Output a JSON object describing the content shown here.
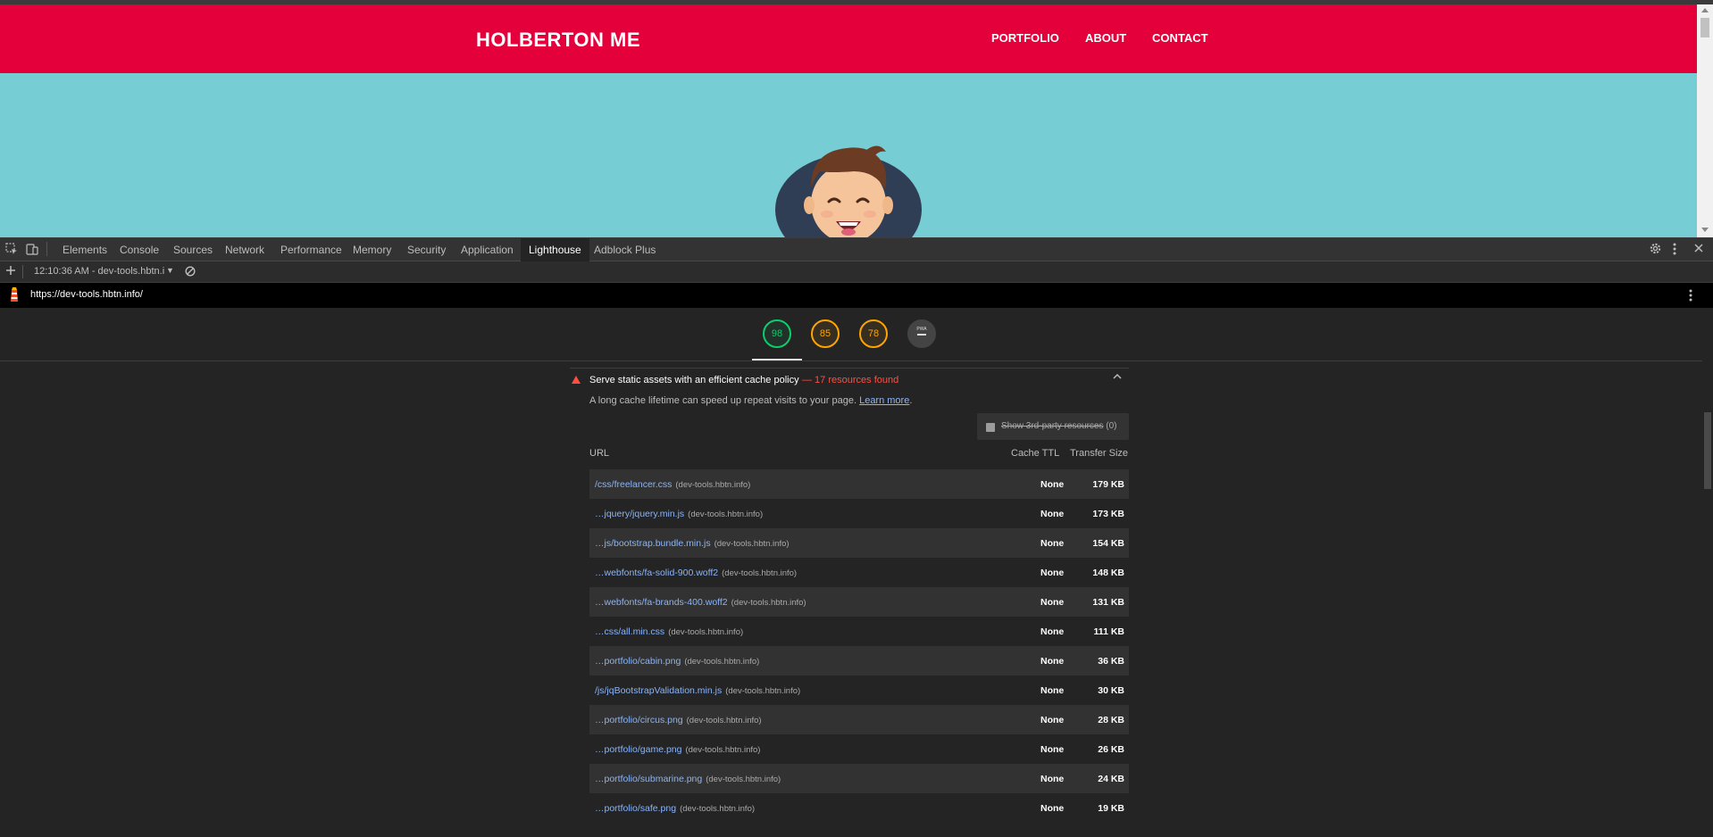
{
  "site": {
    "brand": "HOLBERTON ME",
    "nav": [
      {
        "label": "PORTFOLIO"
      },
      {
        "label": "ABOUT"
      },
      {
        "label": "CONTACT"
      }
    ]
  },
  "devtools": {
    "tabs": [
      {
        "label": "Elements"
      },
      {
        "label": "Console"
      },
      {
        "label": "Sources"
      },
      {
        "label": "Network"
      },
      {
        "label": "Performance"
      },
      {
        "label": "Memory"
      },
      {
        "label": "Security"
      },
      {
        "label": "Application"
      },
      {
        "label": "Lighthouse"
      },
      {
        "label": "Adblock Plus"
      }
    ],
    "active_tab": "Lighthouse",
    "report_selector": "12:10:36 AM - dev-tools.hbtn.i",
    "icons": [
      "inspect-icon",
      "device-toolbar-icon",
      "settings-icon",
      "more-icon",
      "close-icon",
      "add-icon",
      "clear-icon",
      "lighthouse-logo-icon"
    ]
  },
  "lighthouse": {
    "url": "https://dev-tools.hbtn.info/",
    "gauges": [
      {
        "value": "98",
        "status": "pass",
        "color": "#0cce6b"
      },
      {
        "value": "85",
        "status": "average",
        "color": "#ffa400"
      },
      {
        "value": "78",
        "status": "average",
        "color": "#ffa400"
      },
      {
        "value": "PWA",
        "status": "neutral",
        "color": "#cccccc"
      }
    ],
    "audit": {
      "title": "Serve static assets with an efficient cache policy",
      "found": "— 17 resources found",
      "description": "A long cache lifetime can speed up repeat visits to your page.",
      "learn_more": "Learn more",
      "third_party_label": "Show 3rd-party resources",
      "third_party_count": "(0)",
      "columns": {
        "url": "URL",
        "ttl": "Cache TTL",
        "size": "Transfer Size"
      },
      "rows": [
        {
          "url": "/css/freelancer.css",
          "host": "(dev-tools.hbtn.info)",
          "ttl": "None",
          "size": "179 KB"
        },
        {
          "url": "…jquery/jquery.min.js",
          "host": "(dev-tools.hbtn.info)",
          "ttl": "None",
          "size": "173 KB"
        },
        {
          "url": "…js/bootstrap.bundle.min.js",
          "host": "(dev-tools.hbtn.info)",
          "ttl": "None",
          "size": "154 KB"
        },
        {
          "url": "…webfonts/fa-solid-900.woff2",
          "host": "(dev-tools.hbtn.info)",
          "ttl": "None",
          "size": "148 KB"
        },
        {
          "url": "…webfonts/fa-brands-400.woff2",
          "host": "(dev-tools.hbtn.info)",
          "ttl": "None",
          "size": "131 KB"
        },
        {
          "url": "…css/all.min.css",
          "host": "(dev-tools.hbtn.info)",
          "ttl": "None",
          "size": "111 KB"
        },
        {
          "url": "…portfolio/cabin.png",
          "host": "(dev-tools.hbtn.info)",
          "ttl": "None",
          "size": "36 KB"
        },
        {
          "url": "/js/jqBootstrapValidation.min.js",
          "host": "(dev-tools.hbtn.info)",
          "ttl": "None",
          "size": "30 KB"
        },
        {
          "url": "…portfolio/circus.png",
          "host": "(dev-tools.hbtn.info)",
          "ttl": "None",
          "size": "28 KB"
        },
        {
          "url": "…portfolio/game.png",
          "host": "(dev-tools.hbtn.info)",
          "ttl": "None",
          "size": "26 KB"
        },
        {
          "url": "…portfolio/submarine.png",
          "host": "(dev-tools.hbtn.info)",
          "ttl": "None",
          "size": "24 KB"
        },
        {
          "url": "…portfolio/safe.png",
          "host": "(dev-tools.hbtn.info)",
          "ttl": "None",
          "size": "19 KB"
        }
      ]
    }
  },
  "colors": {
    "site_nav": "#e4003a",
    "site_bg": "#76cdd3",
    "pass": "#0cce6b",
    "average": "#ffa400",
    "fail": "#ff4e42",
    "link": "#8ab4f8"
  }
}
